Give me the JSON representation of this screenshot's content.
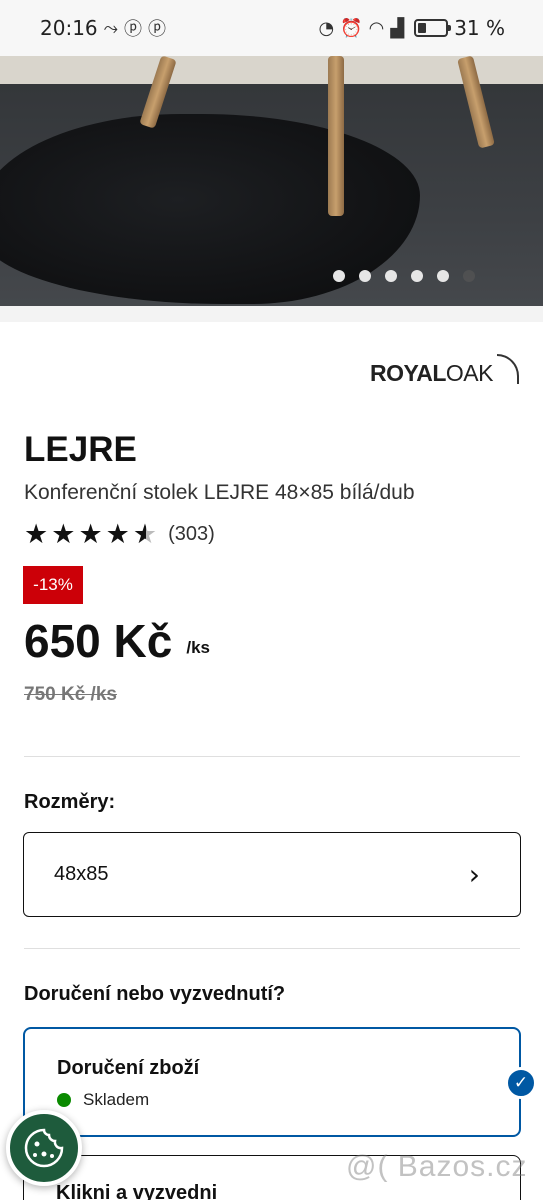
{
  "status_bar": {
    "time": "20:16",
    "battery_percent": "31 %",
    "battery_level": 0.31,
    "left_icons": [
      "missed-call-icon",
      "pinterest-icon",
      "pinterest-icon"
    ],
    "right_icons": [
      "data-saver-icon",
      "alarm-icon",
      "wifi-icon",
      "signal-icon",
      "battery-icon"
    ]
  },
  "gallery": {
    "image_count": 6,
    "active_index": 5
  },
  "brand": {
    "logo_text_bold": "ROYAL",
    "logo_text_light": "OAK"
  },
  "product": {
    "name": "LEJRE",
    "description": "Konferenční stolek LEJRE 48×85 bílá/dub",
    "rating": 4.5,
    "review_count": "(303)",
    "discount": "-13%",
    "price": "650 Kč",
    "price_unit": "/ks",
    "old_price": "750 Kč /ks"
  },
  "size": {
    "label": "Rozměry:",
    "value": "48x85"
  },
  "delivery": {
    "heading": "Doručení nebo vyzvednutí?",
    "options": [
      {
        "title": "Doručení zboží",
        "status": "Skladem",
        "selected": true
      },
      {
        "title": "Klikni a vyzvedni",
        "selected": false
      }
    ]
  },
  "watermark": {
    "text": "@( Bazos.cz"
  },
  "colors": {
    "accent_blue": "#0058a3",
    "discount_red": "#cc0008",
    "stock_green": "#0a8a00",
    "cookie_green": "#1e5b3c"
  }
}
